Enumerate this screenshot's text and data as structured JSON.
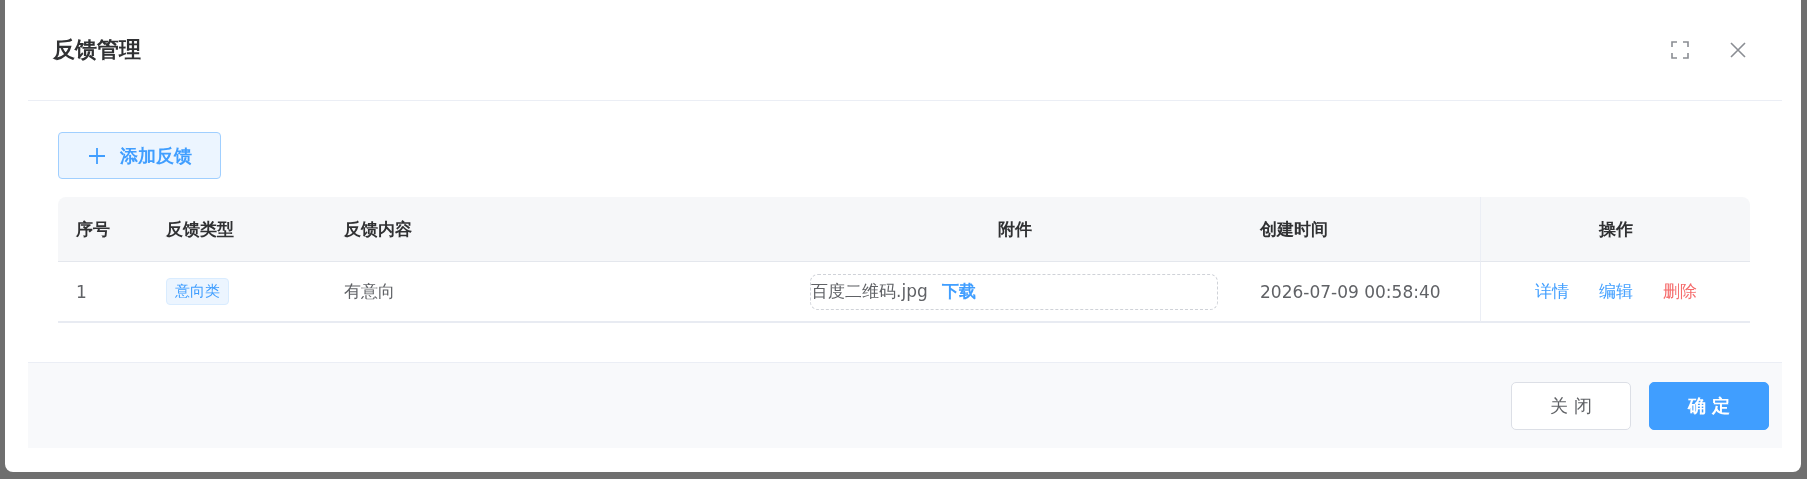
{
  "dialog": {
    "title": "反馈管理",
    "add_button": {
      "label": "添加反馈"
    },
    "table": {
      "columns": [
        "序号",
        "反馈类型",
        "反馈内容",
        "附件",
        "创建时间",
        "操作"
      ],
      "rows": [
        {
          "index": "1",
          "type_tag": "意向类",
          "content": "有意向",
          "attachment": {
            "file_name": "百度二维码.jpg",
            "link": "下载"
          },
          "created": "2026-07-09 00:58:40",
          "actions": [
            {
              "label": "详情",
              "kind": "normal"
            },
            {
              "label": "编辑",
              "kind": "normal"
            },
            {
              "label": "删除",
              "kind": "danger"
            }
          ]
        }
      ]
    },
    "footer_buttons": [
      {
        "label": "关闭",
        "kind": "default"
      },
      {
        "label": "确定",
        "kind": "primary"
      }
    ]
  }
}
